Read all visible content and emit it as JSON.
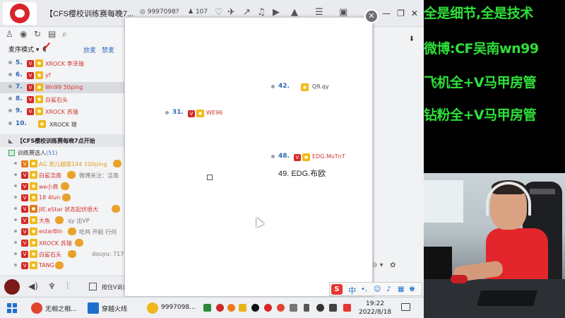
{
  "yy": {
    "title": "【CFS樱校训练赛每晚7...",
    "stats": {
      "viewers": "9997098?",
      "online": "107"
    },
    "mode_label": "麦序模式",
    "mode_links": [
      "放麦",
      "禁麦"
    ],
    "ranking": [
      {
        "no": "5.",
        "name": "XROCK 李泽瑞"
      },
      {
        "no": "6.",
        "name": "yf"
      },
      {
        "no": "7.",
        "name": "Wn99 50ping"
      },
      {
        "no": "8.",
        "name": "白鲨石头"
      },
      {
        "no": "9.",
        "name": "XROCK 苏瑞"
      },
      {
        "no": "10.",
        "name": "XROCK 琦"
      }
    ],
    "channel_title": "【CFS樱校训练赛每晚7点开始",
    "trainee_label": "训练赛选人",
    "trainee_count": "(51)",
    "members": [
      {
        "name": "AG 宠儿越南144 100ping",
        "note": ""
      },
      {
        "name": "白鲨浩南",
        "note": "微博关注：洁南"
      },
      {
        "name": "we小燕",
        "note": ""
      },
      {
        "name": "18 4lun",
        "note": ""
      },
      {
        "name": "JIE.eStar 状态起伏很大",
        "note": ""
      },
      {
        "name": "大鱼",
        "note": "qy 出VP"
      },
      {
        "name": "estarBIn",
        "note": "吃鸡 开船 行何"
      },
      {
        "name": "XROCK 苏瑞",
        "note": ""
      },
      {
        "name": "白鲨石头",
        "note": "douyu: 717"
      },
      {
        "name": "TANG",
        "note": ""
      }
    ],
    "ptt_label": "按住V说话"
  },
  "popup": {
    "entries": [
      {
        "no": "42.",
        "name": "Q9.qy"
      },
      {
        "no": "31.",
        "name": "WE96"
      },
      {
        "no": "48.",
        "name": "EDG.MoTnT"
      }
    ],
    "tooltip": "49. EDG.布欧"
  },
  "promo": {
    "lines": [
      "全是细节,全是技术",
      "微博:CF吴南wn99",
      "飞机全+V马甲房管",
      "钻粉全+V马甲房管"
    ],
    "color": "#2ee03a"
  },
  "taskbar": {
    "apps": [
      {
        "label": "无相之相...",
        "color": "#e0452f"
      },
      {
        "label": "穿越火线",
        "color": "#1f6fcf"
      },
      {
        "label": "9997098...",
        "color": "#f0b81a"
      }
    ],
    "time": "19:22",
    "date": "2022/8/18"
  },
  "ime": {
    "lang": "中"
  }
}
